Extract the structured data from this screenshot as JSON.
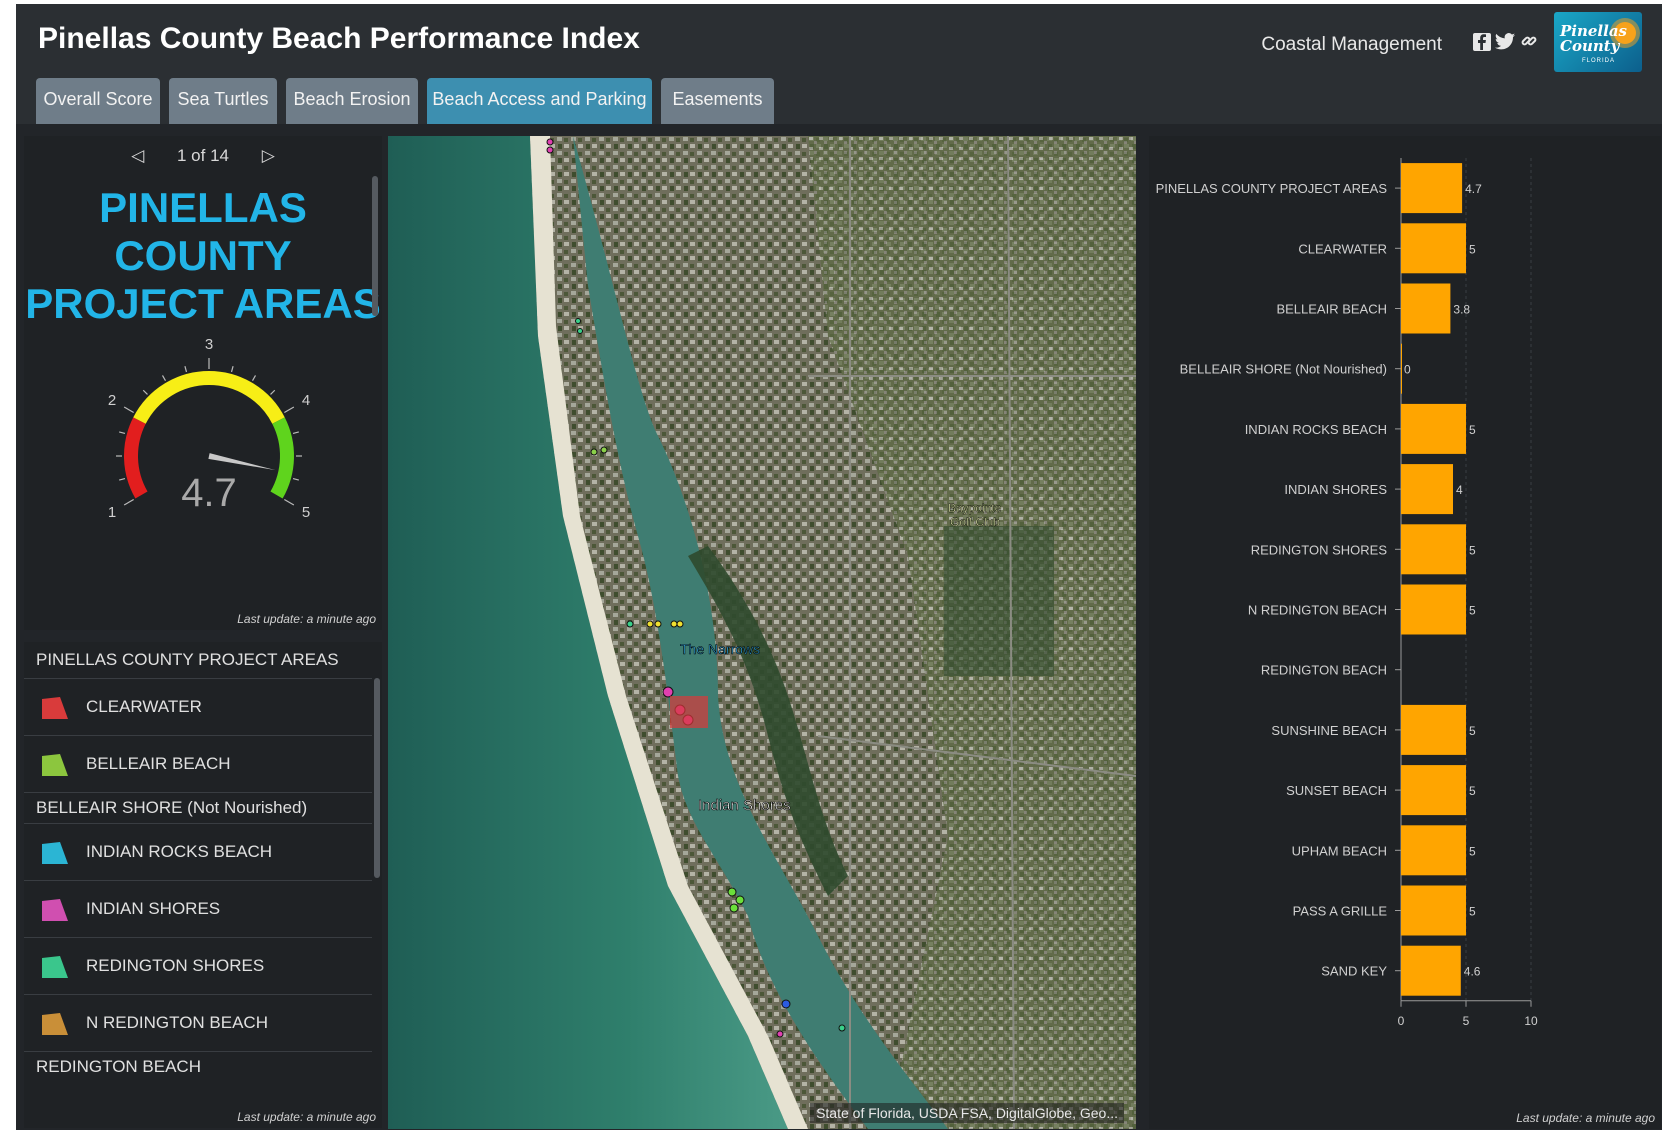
{
  "app": {
    "title": "Pinellas County Beach Performance Index"
  },
  "header": {
    "org": "Coastal Management",
    "social": [
      {
        "icon": "facebook-icon"
      },
      {
        "icon": "twitter-icon"
      },
      {
        "icon": "link-icon"
      }
    ],
    "logo": {
      "line1": "Pinellas",
      "line2": "County",
      "sub": "FLORIDA"
    }
  },
  "tabs": [
    {
      "label": "Overall Score",
      "active": false
    },
    {
      "label": "Sea Turtles",
      "active": false
    },
    {
      "label": "Beach Erosion",
      "active": false
    },
    {
      "label": "Beach Access and Parking",
      "active": true
    },
    {
      "label": "Easements",
      "active": false
    }
  ],
  "indicator": {
    "pager": "1 of 14",
    "title_lines": [
      "PINELLAS",
      "COUNTY",
      "PROJECT AREAS"
    ],
    "gauge": {
      "value": 4.7,
      "min": 1,
      "max": 5,
      "ticks": [
        "1",
        "2",
        "3",
        "4",
        "5"
      ],
      "value_label": "4.7"
    },
    "last_update": "Last update: a minute ago"
  },
  "legend": {
    "header": "PINELLAS COUNTY PROJECT AREAS",
    "items": [
      {
        "label": "CLEARWATER",
        "color": "#d93b3b"
      },
      {
        "label": "BELLEAIR BEACH",
        "color": "#8cc63e"
      },
      {
        "header": "BELLEAIR SHORE (Not Nourished)"
      },
      {
        "label": "INDIAN ROCKS BEACH",
        "color": "#2bb5d4"
      },
      {
        "label": "INDIAN SHORES",
        "color": "#d04fb0"
      },
      {
        "label": "REDINGTON SHORES",
        "color": "#3ac68c"
      },
      {
        "label": "N REDINGTON BEACH",
        "color": "#c98f38"
      },
      {
        "header": "REDINGTON BEACH"
      }
    ],
    "last_update": "Last update: a minute ago"
  },
  "map": {
    "labels": {
      "narrows": "The Narrows",
      "indian_shores": "Indian Shores",
      "golf": "Baypointe Golf Club"
    },
    "attribution": "State of Florida, USDA FSA, DigitalGlobe, Geo..."
  },
  "chart_data": {
    "type": "bar",
    "orientation": "horizontal",
    "categories": [
      "PINELLAS COUNTY PROJECT AREAS",
      "CLEARWATER",
      "BELLEAIR BEACH",
      "BELLEAIR SHORE (Not Nourished)",
      "INDIAN ROCKS BEACH",
      "INDIAN SHORES",
      "REDINGTON SHORES",
      "N REDINGTON BEACH",
      "REDINGTON BEACH",
      "SUNSHINE BEACH",
      "SUNSET BEACH",
      "UPHAM BEACH",
      "PASS A GRILLE",
      "SAND KEY"
    ],
    "values": [
      4.7,
      5,
      3.8,
      0,
      5,
      4,
      5,
      5,
      null,
      5,
      5,
      5,
      5,
      4.6
    ],
    "value_labels": [
      "4.7",
      "5",
      "3.8",
      "0",
      "5",
      "4",
      "5",
      "5",
      "",
      "5",
      "5",
      "5",
      "5",
      "4.6"
    ],
    "xlim": [
      0,
      10
    ],
    "xticks": [
      "0",
      "5",
      "10"
    ],
    "bar_color": "#ffa500",
    "grid": true,
    "last_update": "Last update: a minute ago"
  }
}
